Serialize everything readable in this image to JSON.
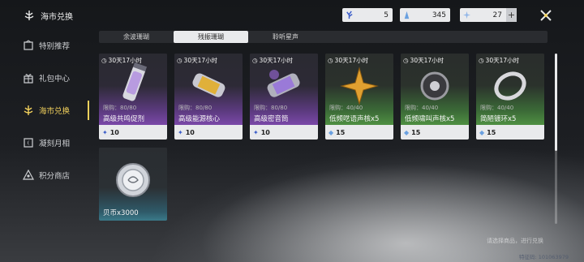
{
  "header": {
    "title": "海市兑换",
    "currencies": [
      {
        "icon": "coral-icon",
        "value": "5"
      },
      {
        "icon": "crystal-icon",
        "value": "345"
      },
      {
        "icon": "star-crystal-icon",
        "value": "27"
      }
    ]
  },
  "sidebar": {
    "items": [
      {
        "label": "特别推荐",
        "icon": "recommend-icon",
        "active": false
      },
      {
        "label": "礼包中心",
        "icon": "gift-icon",
        "active": false
      },
      {
        "label": "海市兑换",
        "icon": "exchange-icon",
        "active": true
      },
      {
        "label": "凝刻月相",
        "icon": "moon-icon",
        "active": false
      },
      {
        "label": "积分商店",
        "icon": "points-icon",
        "active": false
      }
    ]
  },
  "tabs": [
    {
      "label": "余波珊瑚",
      "active": false
    },
    {
      "label": "残振珊瑚",
      "active": true
    },
    {
      "label": "聆听星声",
      "active": false
    }
  ],
  "items": [
    {
      "timer": "30天17小时",
      "limit": "限购：80/80",
      "name": "高级共鸣促剂",
      "price": "10",
      "rarity": "purple",
      "art": "vial"
    },
    {
      "timer": "30天17小时",
      "limit": "限购：80/80",
      "name": "高级能源核心",
      "price": "10",
      "rarity": "purple",
      "art": "capsule-gold"
    },
    {
      "timer": "30天17小时",
      "limit": "限购：80/80",
      "name": "高级密音筒",
      "price": "10",
      "rarity": "purple",
      "art": "capsule-silver"
    },
    {
      "timer": "30天17小时",
      "limit": "限购：40/40",
      "name": "低频呓语声核x5",
      "price": "15",
      "rarity": "green",
      "art": "star-shard"
    },
    {
      "timer": "30天17小时",
      "limit": "限购：40/40",
      "name": "低频啸叫声核x5",
      "price": "15",
      "rarity": "green",
      "art": "dark-core"
    },
    {
      "timer": "30天17小时",
      "limit": "限购：40/40",
      "name": "简陋镀环x5",
      "price": "15",
      "rarity": "green",
      "art": "ring"
    },
    {
      "timer": "",
      "limit": "",
      "name": "贝币x3000",
      "price": "",
      "rarity": "teal",
      "art": "coin"
    }
  ],
  "colors": {
    "active_accent": "#f2d15c",
    "purple": "#7a48a8",
    "green": "#4f8f42",
    "teal": "#3a7a8a"
  },
  "footer": {
    "text": "请选择商品，进行兑换",
    "uid": "特征码: 101063979"
  }
}
